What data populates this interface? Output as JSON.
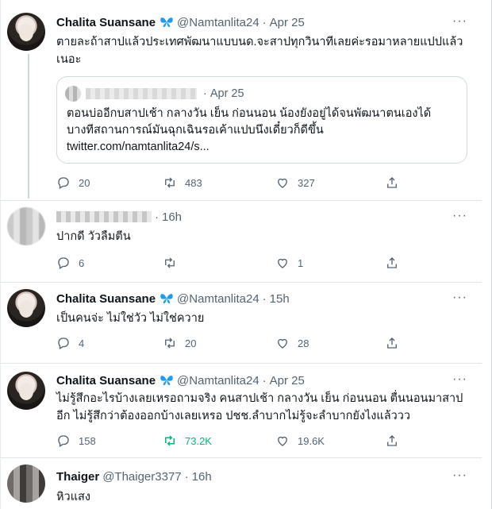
{
  "tweets": [
    {
      "name": "Chalita Suansane",
      "handle": "@Namtanlita24",
      "time": "Apr 25",
      "text_line1": "ตายละถ้าสาปแล้วประเทศพัฒนาแบบนด.จะสาปทุกวินาทีเลยค่ะรอมาหลายแปปแล้ว",
      "text_line2": "เนอะ",
      "quote": {
        "time": "Apr 25",
        "line1": "ตอนบ่ออีกบสาปเช้า กลางวัน เย็น ก่อนนอน น้องยังอยู่ได้จนพัฒนาตนเองได้",
        "line2": "บางทีสถานการณ์มันฉุกเฉินรอเค้าแปบนึงเดี๋ยวก็ดีขึ้น",
        "line3": "twitter.com/namtanlita24/s..."
      },
      "replies": "20",
      "retweets": "483",
      "likes": "327"
    },
    {
      "time": "16h",
      "text": "ปากดี วัวลืมตีน",
      "replies": "6",
      "retweets": "",
      "likes": "1"
    },
    {
      "name": "Chalita Suansane",
      "handle": "@Namtanlita24",
      "time": "15h",
      "text": "เป็นคนจ่ะ ไม่ใช่วัว ไม่ใช่ควาย",
      "replies": "4",
      "retweets": "20",
      "likes": "28"
    },
    {
      "name": "Chalita Suansane",
      "handle": "@Namtanlita24",
      "time": "Apr 25",
      "text_line1": "ไม่รู้สึกอะไรบ้างเลยเหรอถามจริง คนสาปเช้า กลางวัน เย็น ก่อนนอน ตื่นนอนมาสาป",
      "text_line2": "อีก ไม่รู้สึกว่าต้องออกบ้างเลยเหรอ ปชช.ลำบากไม่รู้จะลำบากยังไงแล้ววว",
      "replies": "158",
      "retweets": "73.2K",
      "likes": "19.6K"
    },
    {
      "name": "Thaiger",
      "handle": "@Thaiger3377",
      "time": "16h",
      "text": "หิวแสง"
    }
  ],
  "more_label": "···",
  "dot": "·",
  "colors": {
    "accent": "#1d9bf0",
    "retweet_green": "#00ba7c",
    "secondary": "#536471",
    "butterfly": "#1d9bf0"
  },
  "icons": [
    "reply-icon",
    "retweet-icon",
    "like-icon",
    "share-icon",
    "butterfly-icon",
    "more-icon"
  ]
}
